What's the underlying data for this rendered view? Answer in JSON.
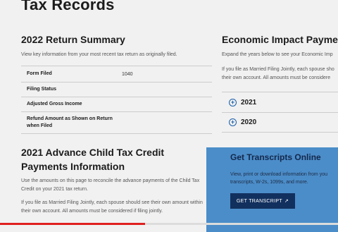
{
  "page": {
    "title": "Tax Records"
  },
  "summary": {
    "title": "2022 Return Summary",
    "description": "View key information from your most recent tax return as originally filed.",
    "rows": [
      {
        "label": "Form Filed",
        "value": "1040"
      },
      {
        "label": "Filing Status",
        "value": ""
      },
      {
        "label": "Adjusted Gross Income",
        "value": ""
      },
      {
        "label": "Refund Amount as Shown on Return when Filed",
        "value": ""
      }
    ]
  },
  "ctc": {
    "title": "2021 Advance Child Tax Credit Payments Information",
    "description1": "Use the amounts on this page to reconcile the advance payments of the Child Tax Credit on your 2021 tax return.",
    "description2": "If you file as Married Filing Jointly, each spouse should see their own amount within their own account. All amounts must be considered if filing jointly."
  },
  "eip": {
    "title": "Economic Impact Payment",
    "description1": "Expand the years below to see your Economic Imp",
    "description2": "If you file as Married Filing Jointly, each spouse sho their own account. All amounts must be considere",
    "years": [
      "2021",
      "2020"
    ]
  },
  "transcripts": {
    "title": "Get Transcripts Online",
    "description": "View, print or download information from you transcripts, W-2s, 1099s, and more.",
    "button_label": "GET TRANSCRIPT"
  },
  "video_progress": 0.43,
  "colors": {
    "accent": "#1b5faa",
    "panel": "#3d84c6",
    "button": "#12305e",
    "progress": "#e02020"
  }
}
